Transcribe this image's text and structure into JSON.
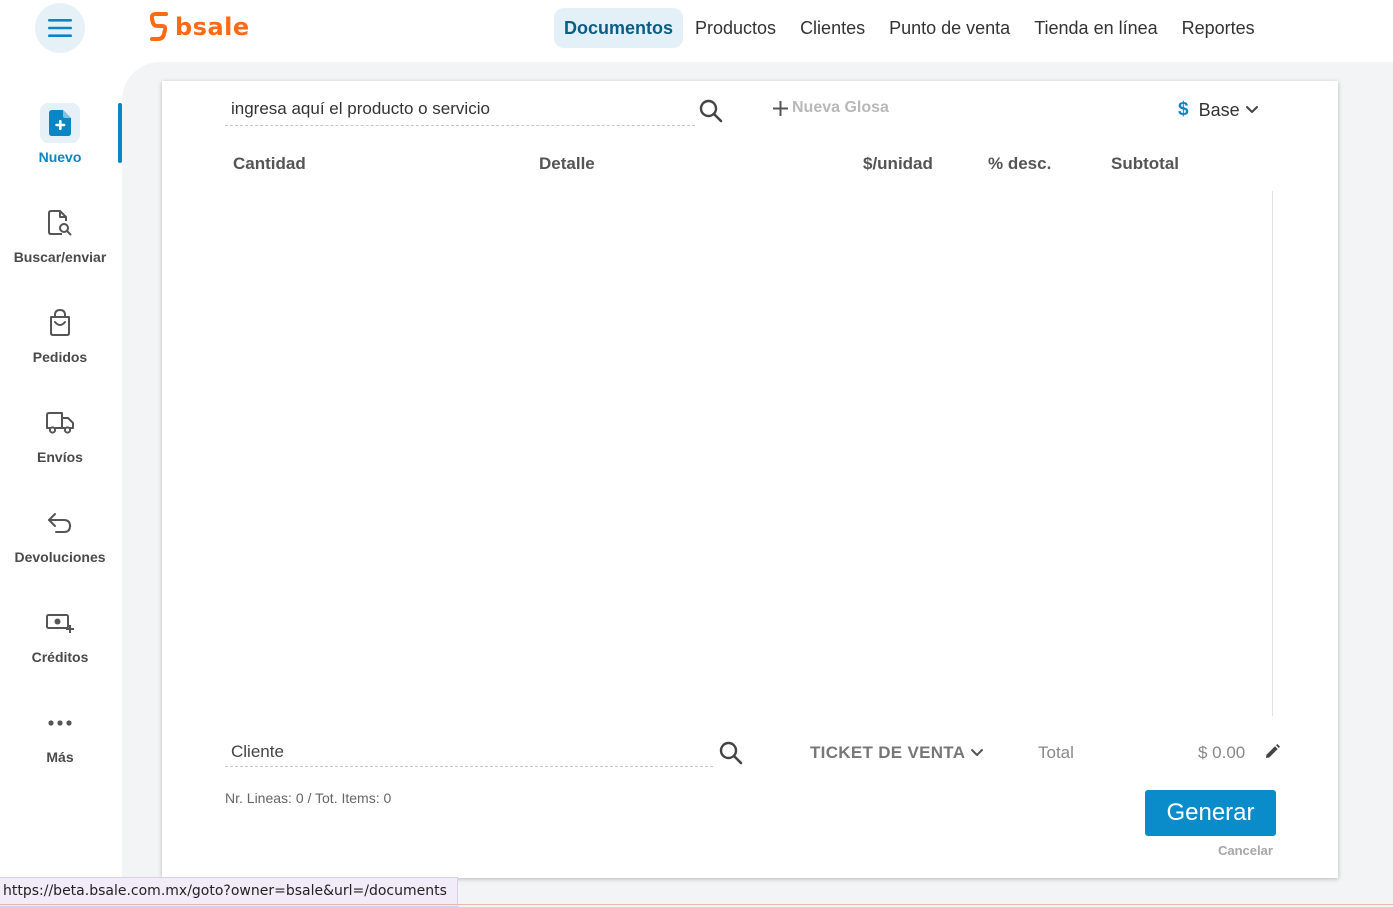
{
  "brand": {
    "name": "bsale",
    "color": "#ff6a13"
  },
  "topbar": {
    "menu_icon": "hamburger-menu-icon",
    "nav": [
      {
        "label": "Documentos",
        "active": true
      },
      {
        "label": "Productos"
      },
      {
        "label": "Clientes"
      },
      {
        "label": "Punto de venta"
      },
      {
        "label": "Tienda en línea"
      },
      {
        "label": "Reportes"
      }
    ]
  },
  "sidebar": {
    "items": [
      {
        "label": "Nuevo",
        "icon": "new-document-icon",
        "active": true
      },
      {
        "label": "Buscar/enviar",
        "icon": "search-document-icon"
      },
      {
        "label": "Pedidos",
        "icon": "shopping-bag-icon"
      },
      {
        "label": "Envíos",
        "icon": "truck-icon"
      },
      {
        "label": "Devoluciones",
        "icon": "return-arrow-icon"
      },
      {
        "label": "Créditos",
        "icon": "cash-plus-icon"
      },
      {
        "label": "Más",
        "icon": "more-dots-icon"
      }
    ]
  },
  "document": {
    "product_search": {
      "placeholder": "ingresa aquí el producto o servicio",
      "value": ""
    },
    "new_gloss_label": "Nueva Glosa",
    "price_list": {
      "symbol": "$",
      "label": "Base"
    },
    "columns": [
      "Cantidad",
      "Detalle",
      "$/unidad",
      "% desc.",
      "Subtotal"
    ],
    "client_search": {
      "placeholder": "Cliente",
      "value": ""
    },
    "document_type": "TICKET DE VENTA",
    "total_label": "Total",
    "total_value": "$ 0.00",
    "lines_summary": "Nr. Lineas: 0 / Tot. Items: 0",
    "generate_label": "Generar",
    "cancel_label": "Cancelar"
  },
  "status_bar": {
    "url": "https://beta.bsale.com.mx/goto?owner=bsale&url=/documents"
  },
  "colors": {
    "accent": "#0a86c4",
    "generate_button": "#0a8ccb",
    "active_nav_bg": "#e4f0f7"
  }
}
